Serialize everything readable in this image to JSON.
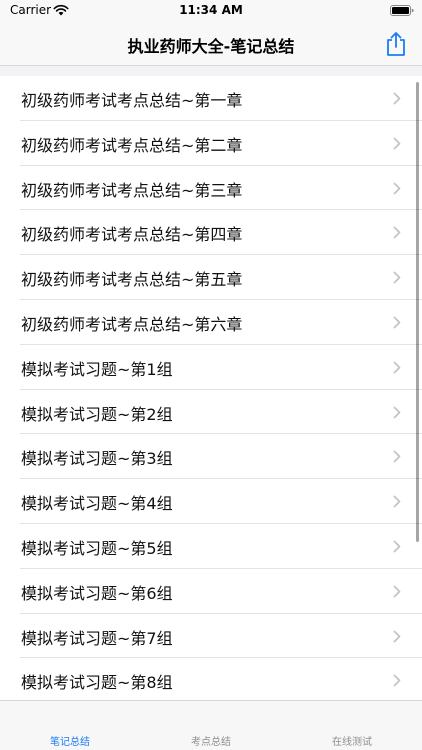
{
  "status_bar": {
    "carrier": "Carrier",
    "time": "11:34 AM"
  },
  "nav": {
    "title": "执业药师大全-笔记总结"
  },
  "list": {
    "items": [
      {
        "label": "初级药师考试考点总结~第一章"
      },
      {
        "label": "初级药师考试考点总结~第二章"
      },
      {
        "label": "初级药师考试考点总结~第三章"
      },
      {
        "label": "初级药师考试考点总结~第四章"
      },
      {
        "label": "初级药师考试考点总结~第五章"
      },
      {
        "label": "初级药师考试考点总结~第六章"
      },
      {
        "label": "模拟考试习题~第1组"
      },
      {
        "label": "模拟考试习题~第2组"
      },
      {
        "label": "模拟考试习题~第3组"
      },
      {
        "label": "模拟考试习题~第4组"
      },
      {
        "label": "模拟考试习题~第5组"
      },
      {
        "label": "模拟考试习题~第6组"
      },
      {
        "label": "模拟考试习题~第7组"
      },
      {
        "label": "模拟考试习题~第8组"
      }
    ]
  },
  "tabs": [
    {
      "label": "笔记总结",
      "active": true
    },
    {
      "label": "考点总结",
      "active": false
    },
    {
      "label": "在线测试",
      "active": false
    }
  ],
  "colors": {
    "accent": "#1a7cf5",
    "inactive_tab": "#8e8e93",
    "chevron": "#c4c4c7"
  }
}
